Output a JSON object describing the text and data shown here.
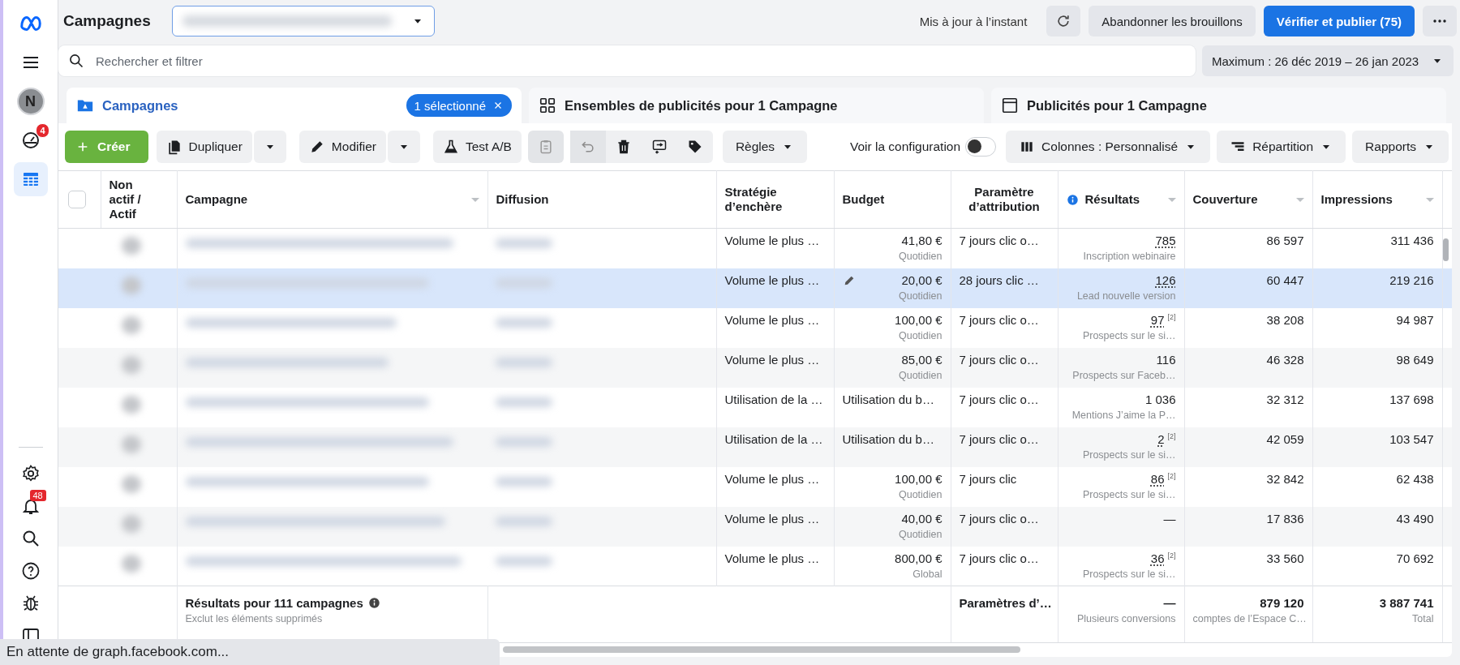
{
  "sidebar": {
    "top": [
      {
        "kind": "logo",
        "selected": false
      },
      {
        "kind": "menu",
        "selected": false
      },
      {
        "kind": "avatar",
        "label": "N",
        "selected": false
      },
      {
        "kind": "gauge",
        "badge": "4",
        "selected": false
      },
      {
        "kind": "table",
        "selected": true
      }
    ],
    "bottom": [
      {
        "kind": "settings",
        "selected": false
      },
      {
        "kind": "bell",
        "badge": "48",
        "selected": false
      },
      {
        "kind": "search",
        "selected": false
      },
      {
        "kind": "help",
        "selected": false
      },
      {
        "kind": "bug",
        "selected": false
      },
      {
        "kind": "panel",
        "selected": false
      }
    ]
  },
  "header": {
    "title": "Campagnes",
    "updated": "Mis à jour à l’instant",
    "buttons": [
      {
        "label": "Abandonner les brouillons",
        "kind": "secondary"
      },
      {
        "label": "Vérifier et publier (75)",
        "kind": "primary"
      }
    ]
  },
  "search": {
    "placeholder": "Rechercher et filtrer"
  },
  "date_range": "Maximum : 26 déc 2019 – 26 jan 2023",
  "tabs": [
    {
      "label": "Campagnes",
      "selected": true,
      "chip": "1 sélectionné",
      "kind": "folder"
    },
    {
      "label": "Ensembles de publicités pour 1 Campagne",
      "selected": false,
      "kind": "grid"
    },
    {
      "label": "Publicités pour 1 Campagne",
      "selected": false,
      "kind": "window"
    }
  ],
  "toolbar": [
    {
      "kind": "create",
      "label": "Créer"
    },
    {
      "kind": "split",
      "label": "Dupliquer"
    },
    {
      "kind": "split",
      "label": "Modifier"
    },
    {
      "kind": "button",
      "label": "Test A/B"
    },
    {
      "kind": "icon",
      "disabled": true
    },
    {
      "kind": "icon",
      "disabled": true
    },
    {
      "kind": "icon",
      "disabled": false
    },
    {
      "kind": "icon",
      "disabled": false
    },
    {
      "kind": "icon",
      "disabled": false
    },
    {
      "kind": "dropdown",
      "label": "Règles"
    },
    {
      "kind": "toggle",
      "label": "Voir la configuration",
      "on": false
    },
    {
      "kind": "dropdown",
      "label": "Colonnes : Personnalisé"
    },
    {
      "kind": "dropdown",
      "label": "Répartition"
    },
    {
      "kind": "dropdown",
      "label": "Rapports"
    }
  ],
  "table": {
    "select_all": {
      "checked": false
    },
    "columns": [
      {
        "label": "Non actif / Actif",
        "sortable": false,
        "info": false
      },
      {
        "label": "Campagne",
        "sortable": true,
        "info": false
      },
      {
        "label": "Diffusion",
        "sortable": false,
        "info": false
      },
      {
        "label": "Stratégie d’enchère",
        "sortable": false,
        "info": false
      },
      {
        "label": "Budget",
        "sortable": false,
        "info": false
      },
      {
        "label": "Paramètre d’attribution",
        "sortable": false,
        "info": false
      },
      {
        "label": "Résultats",
        "sortable": true,
        "info": true
      },
      {
        "label": "Couverture",
        "sortable": true,
        "info": false
      },
      {
        "label": "Impressions",
        "sortable": true,
        "info": false
      }
    ],
    "rows": [
      {
        "selected": false,
        "strategy": "Volume le plus …",
        "budget": "41,80 €",
        "budget_type": "Quotidien",
        "attribution": "7 jours clic o…",
        "result": "785",
        "dotted": true,
        "result_type": "Inscription webinaire",
        "reach": "86 597",
        "impressions": "311 436"
      },
      {
        "selected": true,
        "strategy": "Volume le plus …",
        "budget": "20,00 €",
        "budget_type": "Quotidien",
        "attribution": "28 jours clic …",
        "result": "126",
        "dotted": true,
        "result_type": "Lead nouvelle version",
        "reach": "60 447",
        "impressions": "219 216"
      },
      {
        "selected": false,
        "strategy": "Volume le plus …",
        "budget": "100,00 €",
        "budget_type": "Quotidien",
        "attribution": "7 jours clic o…",
        "result": "97",
        "dotted": true,
        "footnote": "[2]",
        "result_type": "Prospects sur le si…",
        "reach": "38 208",
        "impressions": "94 987"
      },
      {
        "selected": false,
        "strategy": "Volume le plus …",
        "budget": "85,00 €",
        "budget_type": "Quotidien",
        "attribution": "7 jours clic o…",
        "result": "116",
        "dotted": false,
        "result_type": "Prospects sur Faceb…",
        "reach": "46 328",
        "impressions": "98 649"
      },
      {
        "selected": false,
        "strategy": "Utilisation de la …",
        "budget": "Utilisation du b…",
        "attribution": "7 jours clic o…",
        "result": "1 036",
        "dotted": false,
        "result_type": "Mentions J’aime la P…",
        "reach": "32 312",
        "impressions": "137 698"
      },
      {
        "selected": false,
        "strategy": "Utilisation de la …",
        "budget": "Utilisation du b…",
        "attribution": "7 jours clic o…",
        "result": "2",
        "dotted": true,
        "footnote": "[2]",
        "result_type": "Prospects sur le si…",
        "reach": "42 059",
        "impressions": "103 547"
      },
      {
        "selected": false,
        "strategy": "Volume le plus …",
        "budget": "100,00 €",
        "budget_type": "Quotidien",
        "attribution": "7 jours clic",
        "result": "86",
        "dotted": true,
        "footnote": "[2]",
        "result_type": "Prospects sur le si…",
        "reach": "32 842",
        "impressions": "62 438"
      },
      {
        "selected": false,
        "strategy": "Volume le plus …",
        "budget": "40,00 €",
        "budget_type": "Quotidien",
        "attribution": "7 jours clic o…",
        "result": "—",
        "dotted": false,
        "reach": "17 836",
        "impressions": "43 490"
      },
      {
        "selected": false,
        "strategy": "Volume le plus …",
        "budget": "800,00 €",
        "budget_type": "Global",
        "attribution": "7 jours clic o…",
        "result": "36",
        "dotted": true,
        "footnote": "[2]",
        "result_type": "Prospects sur le si…",
        "reach": "33 560",
        "impressions": "70 692"
      }
    ],
    "summary": {
      "title": "Résultats pour 111 campagnes",
      "subtitle": "Exclut les éléments supprimés",
      "attribution": "Paramètres d’…",
      "result": "—",
      "result_caption": "Plusieurs conversions",
      "reach": "879 120",
      "reach_caption": "comptes de l’Espace C…",
      "impressions": "3 887 741",
      "impressions_caption": "Total"
    }
  },
  "status_bar": "En attente de graph.facebook.com..."
}
